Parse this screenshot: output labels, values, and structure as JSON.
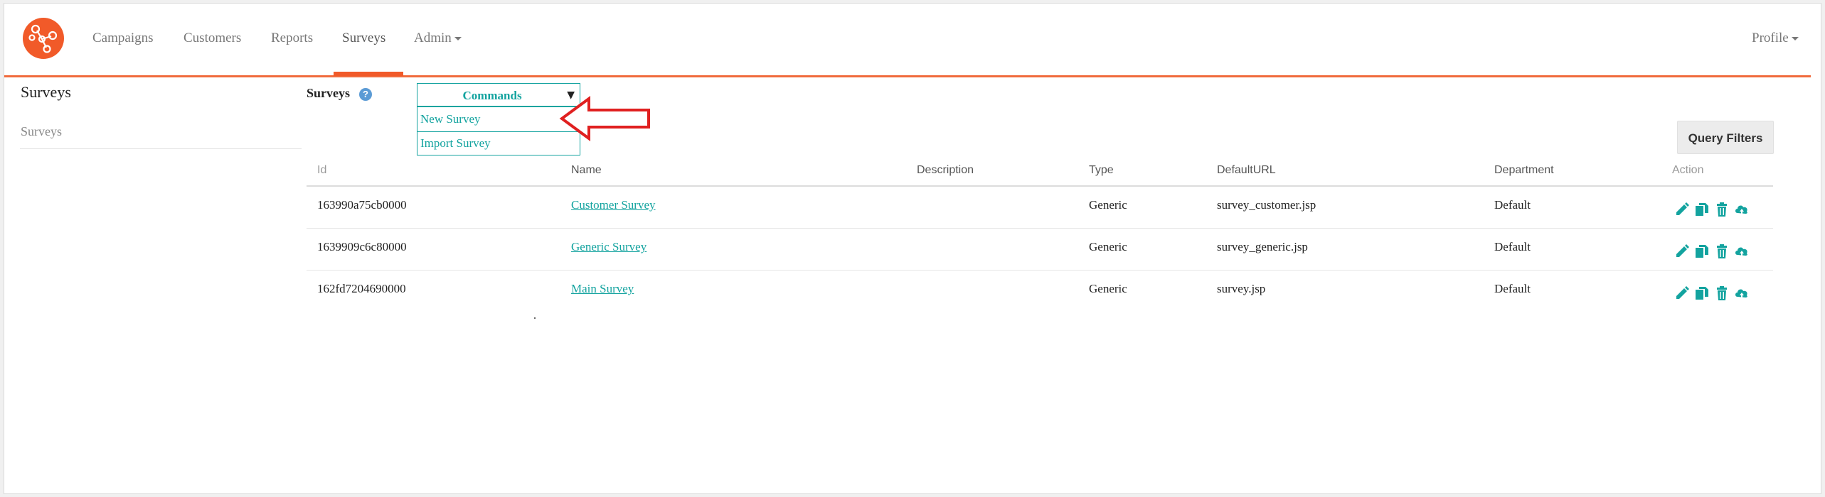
{
  "nav": {
    "items": [
      {
        "label": "Campaigns"
      },
      {
        "label": "Customers"
      },
      {
        "label": "Reports"
      },
      {
        "label": "Surveys"
      },
      {
        "label": "Admin"
      }
    ],
    "active": "Surveys",
    "profile": "Profile"
  },
  "sidebar": {
    "title": "Surveys",
    "items": [
      {
        "label": "Surveys"
      }
    ]
  },
  "main": {
    "title": "Surveys",
    "help_icon": "?",
    "commands": {
      "label": "Commands",
      "arrow": "▼",
      "options": [
        "New Survey",
        "Import Survey"
      ]
    },
    "query_filters": "Query Filters"
  },
  "table": {
    "headers": [
      "Id",
      "Name",
      "Description",
      "Type",
      "DefaultURL",
      "Department",
      "Action"
    ],
    "rows": [
      {
        "id": "163990a75cb0000",
        "name": "Customer Survey",
        "description": "",
        "type": "Generic",
        "url": "survey_customer.jsp",
        "department": "Default"
      },
      {
        "id": "1639909c6c80000",
        "name": "Generic Survey",
        "description": "",
        "type": "Generic",
        "url": "survey_generic.jsp",
        "department": "Default"
      },
      {
        "id": "162fd7204690000",
        "name": "Main Survey",
        "description": "",
        "type": "Generic",
        "url": "survey.jsp",
        "department": "Default"
      }
    ],
    "action_icons": [
      "edit-icon",
      "copy-icon",
      "delete-icon",
      "cloud-upload-icon"
    ]
  },
  "colors": {
    "brand": "#f15a29",
    "accent": "#13a39f",
    "annotation": "#e02020"
  }
}
